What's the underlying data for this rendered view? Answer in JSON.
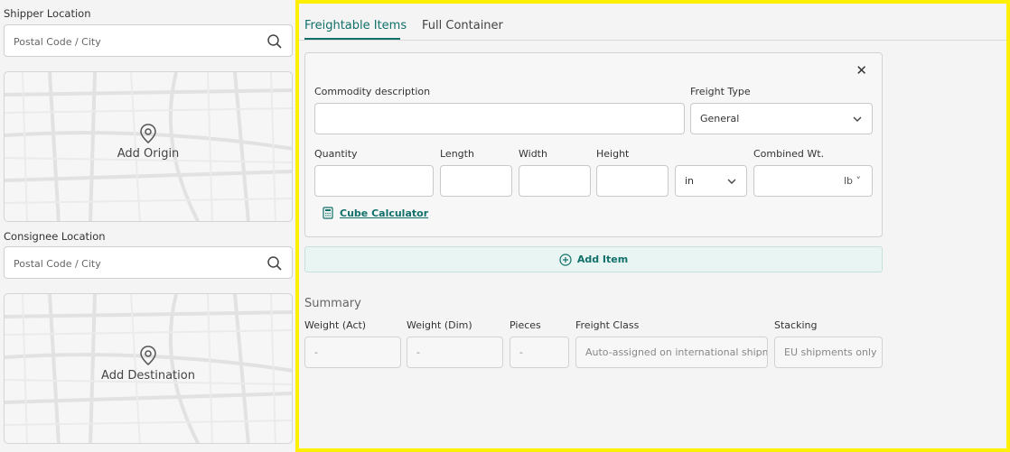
{
  "shipper": {
    "label": "Shipper Location",
    "placeholder": "Postal Code / City",
    "map_label": "Add Origin"
  },
  "consignee": {
    "label": "Consignee Location",
    "placeholder": "Postal Code / City",
    "map_label": "Add Destination"
  },
  "tabs": [
    {
      "label": "Freightable Items",
      "active": true
    },
    {
      "label": "Full Container",
      "active": false
    }
  ],
  "item_form": {
    "close_label": "✕",
    "commodity_label": "Commodity description",
    "commodity_value": "",
    "freight_type_label": "Freight Type",
    "freight_type_value": "General",
    "quantity_label": "Quantity",
    "length_label": "Length",
    "width_label": "Width",
    "height_label": "Height",
    "dim_unit": "in",
    "combined_wt_label": "Combined Wt.",
    "weight_unit": "lb",
    "cube_calculator_label": "Cube Calculator"
  },
  "add_item_label": "Add Item",
  "summary": {
    "title": "Summary",
    "weight_act_label": "Weight (Act)",
    "weight_act_value": "-",
    "weight_dim_label": "Weight (Dim)",
    "weight_dim_value": "-",
    "pieces_label": "Pieces",
    "pieces_value": "-",
    "freight_class_label": "Freight Class",
    "freight_class_value": "Auto-assigned on international shipme",
    "stacking_label": "Stacking",
    "stacking_value": "EU shipments only"
  },
  "colors": {
    "accent": "#11706a",
    "highlight_border": "#ffef00",
    "add_item_bg": "#e8f5f2"
  }
}
